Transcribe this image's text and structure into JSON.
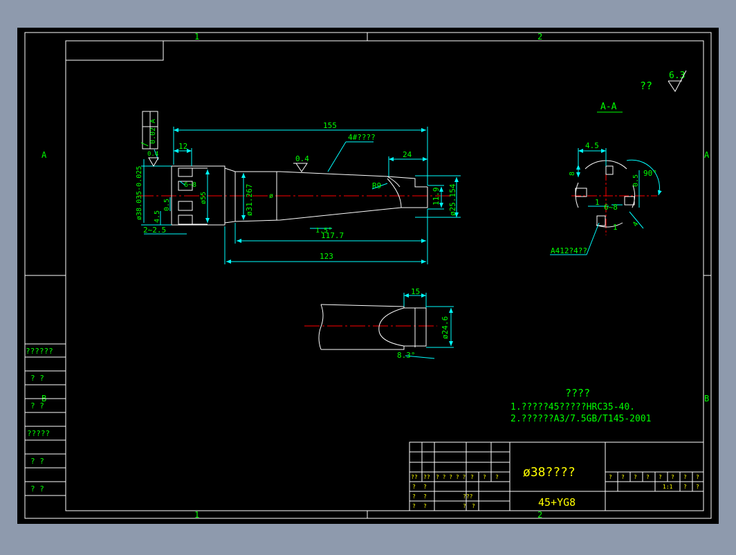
{
  "drawing": {
    "zones": {
      "top": [
        "1",
        "2"
      ],
      "bottom": [
        "1",
        "2"
      ],
      "left": [
        "A",
        "B"
      ],
      "right": [
        "A",
        "B"
      ]
    },
    "left_strip": [
      "??????",
      "?    ?",
      "?    ?",
      "?????",
      "?    ?",
      "?    ?"
    ],
    "roughness": {
      "mark": "??",
      "value": "6.3"
    },
    "section_label": "A-A",
    "dims_main": {
      "length_155": "155",
      "length_12": "12",
      "length_24": "24",
      "length_117": "117.7",
      "length_123": "123",
      "offset_2_25": "2~2.5",
      "dia_38": "ø38.035-0.025",
      "dia_55": "ø55",
      "dia_31": "ø31.267",
      "dia_25": "ø25.154",
      "dim_11_9": "11.9",
      "dim_4_5": "4.5",
      "dim_0_5": "0.5",
      "dim_6_8": "6~8",
      "angle_1_5": "1.5°",
      "r9": "R9",
      "ra_0_4": "0.4",
      "ra_tip": "0.4",
      "taper_note": "4#????",
      "phi": "ø",
      "tol_value": "0.02",
      "tol_datum": "A",
      "tol_symbol": "/"
    },
    "dims_section": {
      "d_4_5": "4.5",
      "d_8": "8",
      "angle_90": "90°",
      "d_0_5": "0.5",
      "d_1": "1",
      "d_6_8": "6~8",
      "d_1b": "1",
      "d_4": "4",
      "leader": "A412?4??"
    },
    "dims_detail": {
      "d_15": "15",
      "dia_24_6": "ø24.6",
      "angle_8_3": "8.3°"
    },
    "notes": {
      "title": "????",
      "line1": "1.?????45?????HRC35-40.",
      "line2": "2.??????A3/7.5GB/T145-2001"
    },
    "title_block": {
      "part_name": "ø38????",
      "material": "45+YG8",
      "scale": "1:1",
      "header_row": [
        "??",
        "??",
        "? ? ? ? ?",
        "?",
        "?",
        "?"
      ],
      "row_a": [
        "?",
        "?"
      ],
      "row_b": [
        "?",
        "?",
        "???"
      ],
      "row_c": [
        "?",
        "?",
        "?",
        "?"
      ],
      "right_row1": [
        "?",
        "?",
        "?",
        "?",
        "?",
        "?",
        "?",
        "?"
      ],
      "right_row2": [
        "?",
        "?"
      ]
    },
    "colors": {
      "border": "#ffffff",
      "outline": "#ffffff",
      "dimension": "#00ff00",
      "dim_line": "#00ffff",
      "centerline": "#ff0000",
      "title_text": "#ffff00",
      "background": "#000000",
      "frame": "#8e9aad"
    }
  }
}
